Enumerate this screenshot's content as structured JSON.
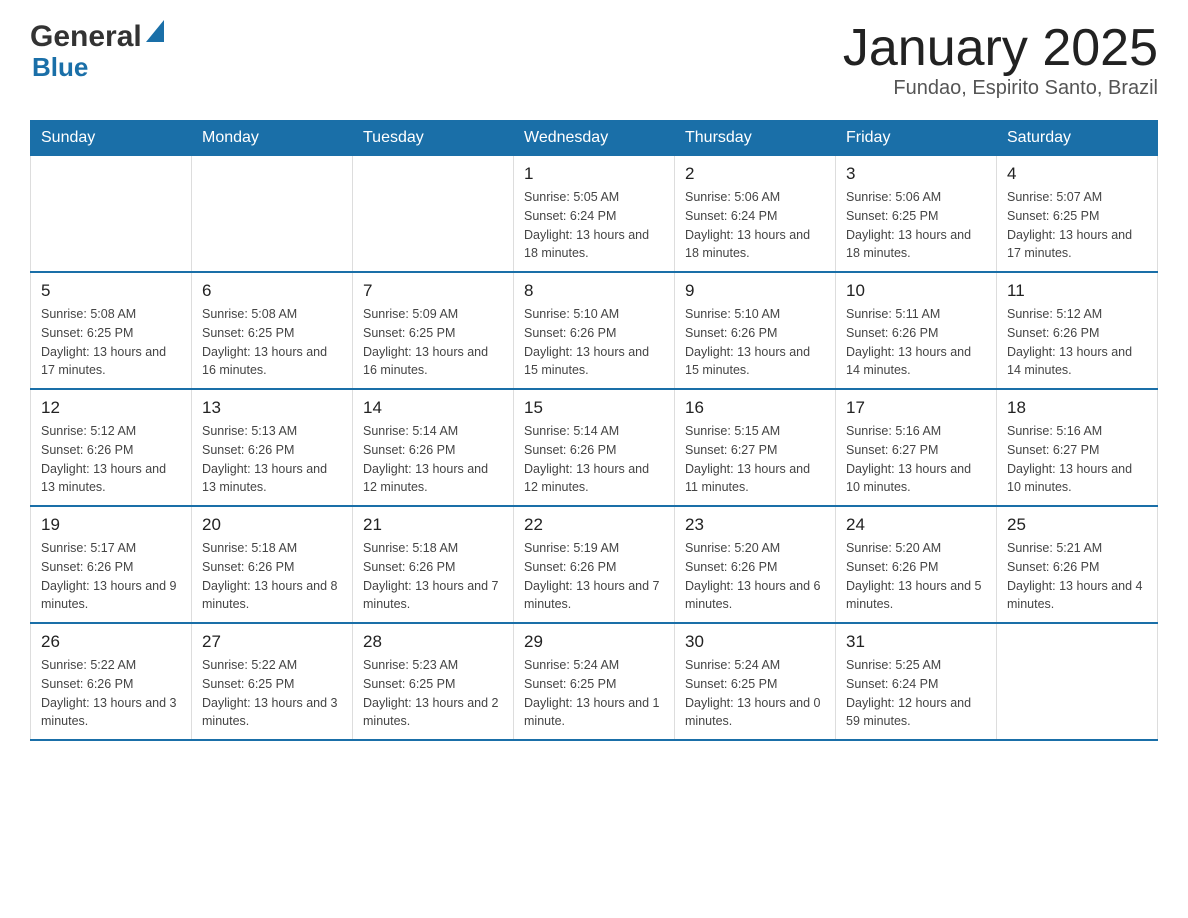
{
  "header": {
    "logo_general": "General",
    "logo_blue": "Blue",
    "title": "January 2025",
    "subtitle": "Fundao, Espirito Santo, Brazil"
  },
  "weekdays": [
    "Sunday",
    "Monday",
    "Tuesday",
    "Wednesday",
    "Thursday",
    "Friday",
    "Saturday"
  ],
  "weeks": [
    [
      {
        "day": "",
        "sunrise": "",
        "sunset": "",
        "daylight": ""
      },
      {
        "day": "",
        "sunrise": "",
        "sunset": "",
        "daylight": ""
      },
      {
        "day": "",
        "sunrise": "",
        "sunset": "",
        "daylight": ""
      },
      {
        "day": "1",
        "sunrise": "Sunrise: 5:05 AM",
        "sunset": "Sunset: 6:24 PM",
        "daylight": "Daylight: 13 hours and 18 minutes."
      },
      {
        "day": "2",
        "sunrise": "Sunrise: 5:06 AM",
        "sunset": "Sunset: 6:24 PM",
        "daylight": "Daylight: 13 hours and 18 minutes."
      },
      {
        "day": "3",
        "sunrise": "Sunrise: 5:06 AM",
        "sunset": "Sunset: 6:25 PM",
        "daylight": "Daylight: 13 hours and 18 minutes."
      },
      {
        "day": "4",
        "sunrise": "Sunrise: 5:07 AM",
        "sunset": "Sunset: 6:25 PM",
        "daylight": "Daylight: 13 hours and 17 minutes."
      }
    ],
    [
      {
        "day": "5",
        "sunrise": "Sunrise: 5:08 AM",
        "sunset": "Sunset: 6:25 PM",
        "daylight": "Daylight: 13 hours and 17 minutes."
      },
      {
        "day": "6",
        "sunrise": "Sunrise: 5:08 AM",
        "sunset": "Sunset: 6:25 PM",
        "daylight": "Daylight: 13 hours and 16 minutes."
      },
      {
        "day": "7",
        "sunrise": "Sunrise: 5:09 AM",
        "sunset": "Sunset: 6:25 PM",
        "daylight": "Daylight: 13 hours and 16 minutes."
      },
      {
        "day": "8",
        "sunrise": "Sunrise: 5:10 AM",
        "sunset": "Sunset: 6:26 PM",
        "daylight": "Daylight: 13 hours and 15 minutes."
      },
      {
        "day": "9",
        "sunrise": "Sunrise: 5:10 AM",
        "sunset": "Sunset: 6:26 PM",
        "daylight": "Daylight: 13 hours and 15 minutes."
      },
      {
        "day": "10",
        "sunrise": "Sunrise: 5:11 AM",
        "sunset": "Sunset: 6:26 PM",
        "daylight": "Daylight: 13 hours and 14 minutes."
      },
      {
        "day": "11",
        "sunrise": "Sunrise: 5:12 AM",
        "sunset": "Sunset: 6:26 PM",
        "daylight": "Daylight: 13 hours and 14 minutes."
      }
    ],
    [
      {
        "day": "12",
        "sunrise": "Sunrise: 5:12 AM",
        "sunset": "Sunset: 6:26 PM",
        "daylight": "Daylight: 13 hours and 13 minutes."
      },
      {
        "day": "13",
        "sunrise": "Sunrise: 5:13 AM",
        "sunset": "Sunset: 6:26 PM",
        "daylight": "Daylight: 13 hours and 13 minutes."
      },
      {
        "day": "14",
        "sunrise": "Sunrise: 5:14 AM",
        "sunset": "Sunset: 6:26 PM",
        "daylight": "Daylight: 13 hours and 12 minutes."
      },
      {
        "day": "15",
        "sunrise": "Sunrise: 5:14 AM",
        "sunset": "Sunset: 6:26 PM",
        "daylight": "Daylight: 13 hours and 12 minutes."
      },
      {
        "day": "16",
        "sunrise": "Sunrise: 5:15 AM",
        "sunset": "Sunset: 6:27 PM",
        "daylight": "Daylight: 13 hours and 11 minutes."
      },
      {
        "day": "17",
        "sunrise": "Sunrise: 5:16 AM",
        "sunset": "Sunset: 6:27 PM",
        "daylight": "Daylight: 13 hours and 10 minutes."
      },
      {
        "day": "18",
        "sunrise": "Sunrise: 5:16 AM",
        "sunset": "Sunset: 6:27 PM",
        "daylight": "Daylight: 13 hours and 10 minutes."
      }
    ],
    [
      {
        "day": "19",
        "sunrise": "Sunrise: 5:17 AM",
        "sunset": "Sunset: 6:26 PM",
        "daylight": "Daylight: 13 hours and 9 minutes."
      },
      {
        "day": "20",
        "sunrise": "Sunrise: 5:18 AM",
        "sunset": "Sunset: 6:26 PM",
        "daylight": "Daylight: 13 hours and 8 minutes."
      },
      {
        "day": "21",
        "sunrise": "Sunrise: 5:18 AM",
        "sunset": "Sunset: 6:26 PM",
        "daylight": "Daylight: 13 hours and 7 minutes."
      },
      {
        "day": "22",
        "sunrise": "Sunrise: 5:19 AM",
        "sunset": "Sunset: 6:26 PM",
        "daylight": "Daylight: 13 hours and 7 minutes."
      },
      {
        "day": "23",
        "sunrise": "Sunrise: 5:20 AM",
        "sunset": "Sunset: 6:26 PM",
        "daylight": "Daylight: 13 hours and 6 minutes."
      },
      {
        "day": "24",
        "sunrise": "Sunrise: 5:20 AM",
        "sunset": "Sunset: 6:26 PM",
        "daylight": "Daylight: 13 hours and 5 minutes."
      },
      {
        "day": "25",
        "sunrise": "Sunrise: 5:21 AM",
        "sunset": "Sunset: 6:26 PM",
        "daylight": "Daylight: 13 hours and 4 minutes."
      }
    ],
    [
      {
        "day": "26",
        "sunrise": "Sunrise: 5:22 AM",
        "sunset": "Sunset: 6:26 PM",
        "daylight": "Daylight: 13 hours and 3 minutes."
      },
      {
        "day": "27",
        "sunrise": "Sunrise: 5:22 AM",
        "sunset": "Sunset: 6:25 PM",
        "daylight": "Daylight: 13 hours and 3 minutes."
      },
      {
        "day": "28",
        "sunrise": "Sunrise: 5:23 AM",
        "sunset": "Sunset: 6:25 PM",
        "daylight": "Daylight: 13 hours and 2 minutes."
      },
      {
        "day": "29",
        "sunrise": "Sunrise: 5:24 AM",
        "sunset": "Sunset: 6:25 PM",
        "daylight": "Daylight: 13 hours and 1 minute."
      },
      {
        "day": "30",
        "sunrise": "Sunrise: 5:24 AM",
        "sunset": "Sunset: 6:25 PM",
        "daylight": "Daylight: 13 hours and 0 minutes."
      },
      {
        "day": "31",
        "sunrise": "Sunrise: 5:25 AM",
        "sunset": "Sunset: 6:24 PM",
        "daylight": "Daylight: 12 hours and 59 minutes."
      },
      {
        "day": "",
        "sunrise": "",
        "sunset": "",
        "daylight": ""
      }
    ]
  ]
}
